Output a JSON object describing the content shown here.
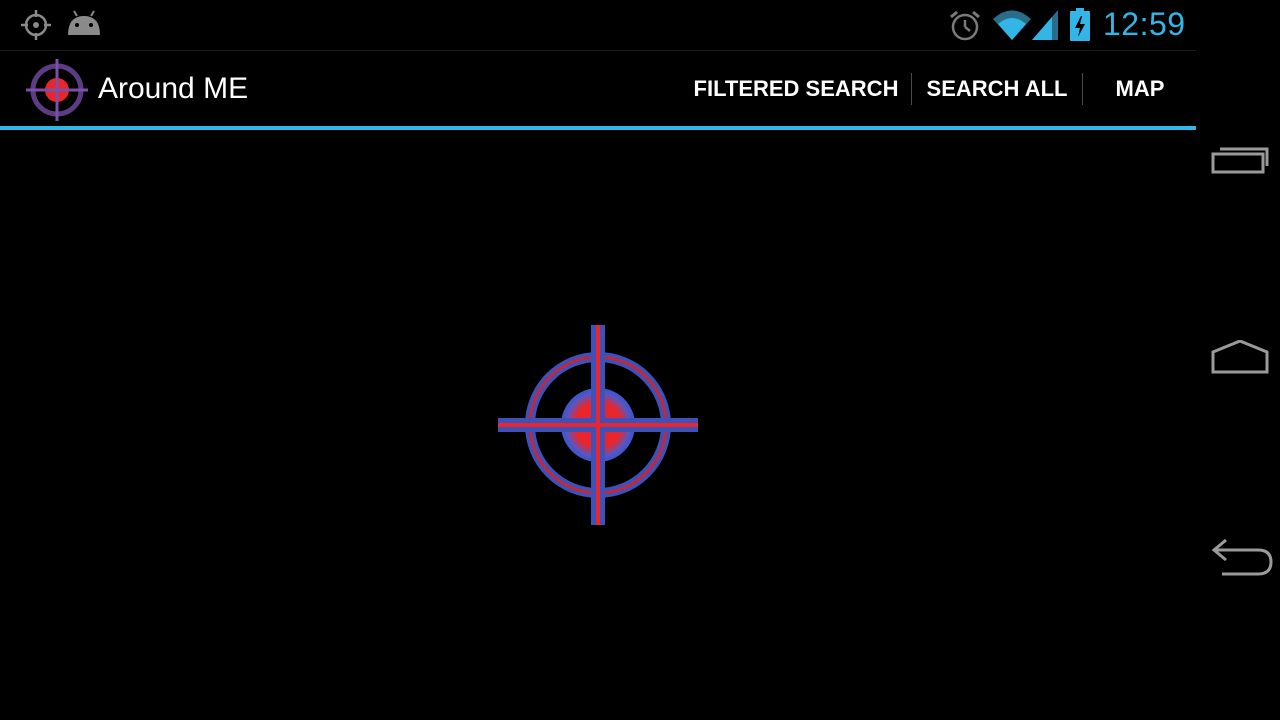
{
  "status_bar": {
    "time": "12:59",
    "left_icons": [
      "location-icon",
      "android-icon"
    ],
    "right_icons": [
      "alarm-icon",
      "wifi-icon",
      "signal-icon",
      "battery-charging-icon"
    ],
    "clock_color": "#33b5e5"
  },
  "action_bar": {
    "app_title": "Around ME",
    "logo_icon": "crosshair-logo-icon",
    "actions": [
      {
        "label": "FILTERED SEARCH"
      },
      {
        "label": "SEARCH ALL"
      },
      {
        "label": "MAP"
      }
    ],
    "accent_color": "#33b5e5"
  },
  "content": {
    "graphic_icon": "crosshair-target-icon",
    "colors": {
      "ring": "#3a4fb0",
      "center": "#e8262b",
      "crosshair": "#e8262b"
    }
  },
  "navigation_bar": {
    "buttons": [
      "recents-icon",
      "home-icon",
      "back-icon"
    ]
  }
}
